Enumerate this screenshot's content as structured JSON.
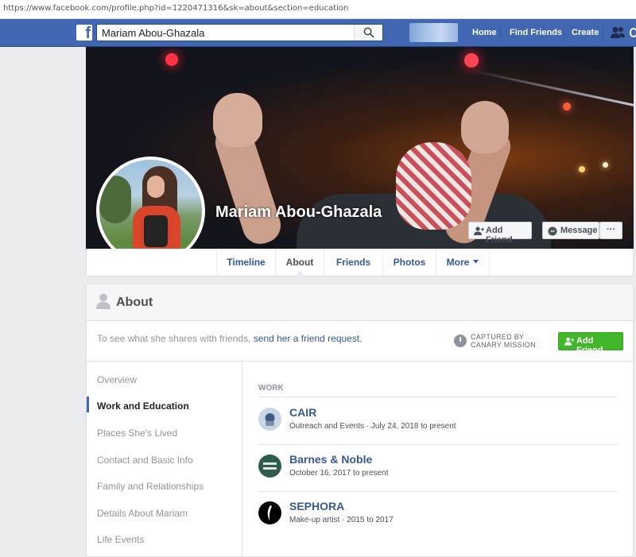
{
  "browser": {
    "url": "https://www.facebook.com/profile.php?id=1220471316&sk=about&section=education"
  },
  "topbar": {
    "search_value": "Mariam Abou-Ghazala",
    "nav": [
      "Home",
      "Find Friends",
      "Create"
    ]
  },
  "profile": {
    "name": "Mariam Abou-Ghazala",
    "add_friend_label": "Add Friend",
    "message_label": "Message",
    "more_dots": "···"
  },
  "tabs": [
    "Timeline",
    "About",
    "Friends",
    "Photos",
    "More"
  ],
  "about": {
    "title": "About",
    "notice_text": "To see what she shares with friends, ",
    "notice_link": "send her a friend request.",
    "captured_line1": "CAPTURED BY",
    "captured_line2": "CANARY MISSION",
    "add_friend_label": "Add Friend"
  },
  "sidebar": {
    "items": [
      "Overview",
      "Work and Education",
      "Places She's Lived",
      "Contact and Basic Info",
      "Family and Relationships",
      "Details About Mariam",
      "Life Events"
    ]
  },
  "work": {
    "section_label": "WORK",
    "entries": [
      {
        "name": "CAIR",
        "detail": "Outreach and Events · July 24, 2018 to present"
      },
      {
        "name": "Barnes & Noble",
        "detail": "October 16, 2017 to present",
        "logo_text": "BARNES & NOBLE"
      },
      {
        "name": "SEPHORA",
        "detail": "Make-up artist · 2015 to 2017"
      }
    ]
  },
  "colors": {
    "brand_blue": "#4267b2",
    "link": "#365899",
    "green": "#42b72a"
  }
}
